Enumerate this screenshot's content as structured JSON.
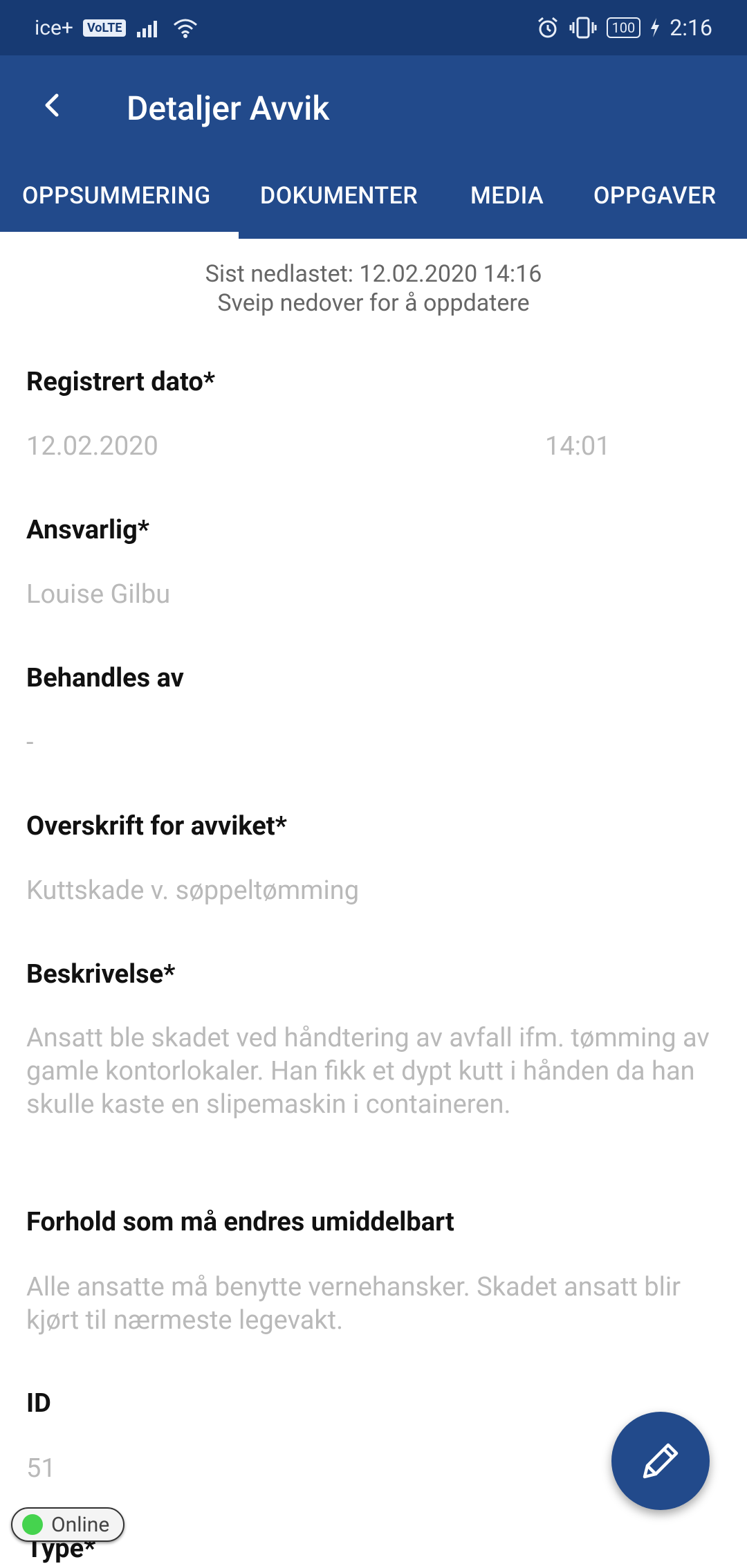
{
  "status_bar": {
    "carrier": "ice+",
    "volte": "VoLTE",
    "battery": "100",
    "time": "2:16"
  },
  "app_bar": {
    "title": "Detaljer Avvik"
  },
  "tabs": [
    {
      "label": "OPPSUMMERING",
      "active": true
    },
    {
      "label": "DOKUMENTER",
      "active": false
    },
    {
      "label": "MEDIA",
      "active": false
    },
    {
      "label": "OPPGAVER",
      "active": false
    }
  ],
  "sync": {
    "last_downloaded": "Sist nedlastet: 12.02.2020 14:16",
    "hint": "Sveip nedover for å oppdatere"
  },
  "fields": {
    "registered": {
      "label": "Registrert dato*",
      "date": "12.02.2020",
      "time": "14:01"
    },
    "responsible": {
      "label": "Ansvarlig*",
      "value": "Louise Gilbu"
    },
    "handled_by": {
      "label": "Behandles av",
      "value": "-"
    },
    "heading": {
      "label": "Overskrift for avviket*",
      "value": "Kuttskade v. søppeltømming"
    },
    "description": {
      "label": "Beskrivelse*",
      "value": "Ansatt ble skadet ved håndtering av avfall ifm. tømming av gamle kontorlokaler. Han fikk et dypt kutt i hånden da han skulle kaste en slipemaskin i containeren."
    },
    "immediate": {
      "label": "Forhold som må endres umiddelbart",
      "value": "Alle ansatte må benytte vernehansker. Skadet ansatt blir kjørt til nærmeste legevakt."
    },
    "id": {
      "label": "ID",
      "value": "51"
    },
    "type": {
      "label": "Type*"
    }
  },
  "online_indicator": {
    "label": "Online"
  },
  "colors": {
    "status_bar": "#173a73",
    "primary": "#224a8b",
    "online_dot": "#45d34e",
    "value_text": "#b9b9b9"
  }
}
